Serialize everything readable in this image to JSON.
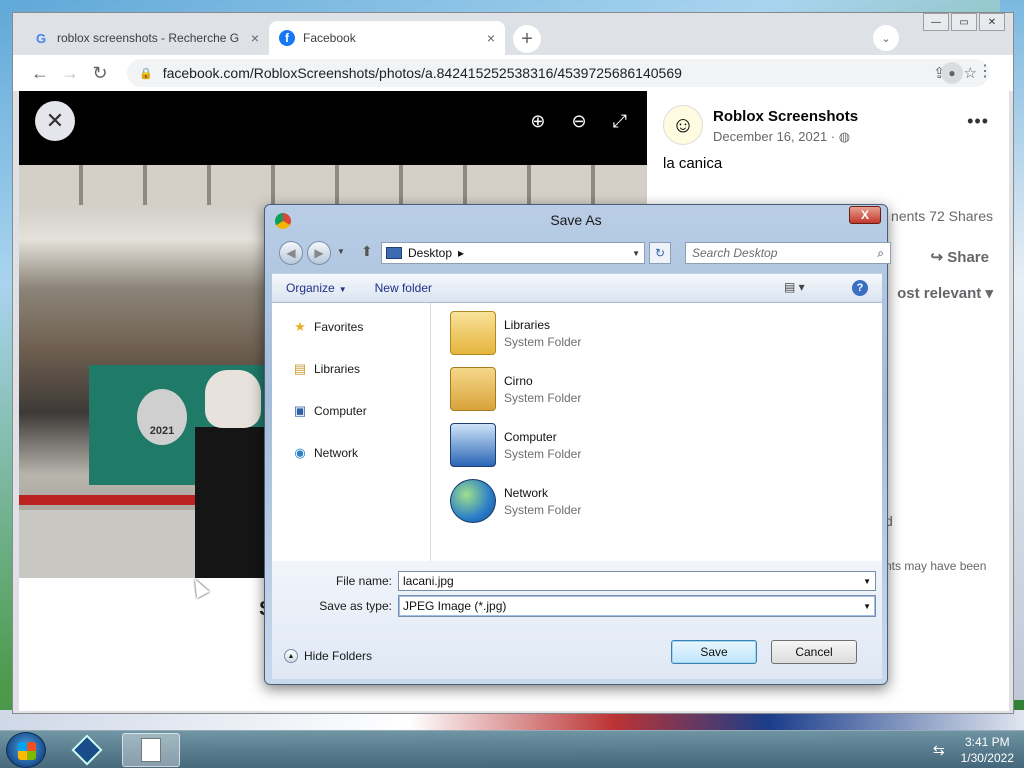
{
  "browser": {
    "tabs": [
      {
        "title": "roblox screenshots - Recherche G",
        "icon": "google-icon",
        "active": false
      },
      {
        "title": "Facebook",
        "icon": "facebook-icon",
        "active": true
      }
    ],
    "url": "facebook.com/RobloxScreenshots/photos/a.842415252538316/4539725686140569",
    "icons": {
      "tab_close": "×",
      "new_tab": "+",
      "tab_search": "⌄",
      "back": "←",
      "forward": "→",
      "reload": "↻",
      "lock": "🔒",
      "share": "⇪",
      "star": "☆",
      "menu": "⋮",
      "profile": "●",
      "win_min": "—",
      "win_max": "▭",
      "win_close": "✕"
    }
  },
  "photo_viewer": {
    "close_icon": "✕",
    "zoom_in_icon": "⊕",
    "zoom_out_icon": "⊖",
    "fullscreen_icon": "⤢",
    "seal_text": "2021",
    "partial_text": "S"
  },
  "post": {
    "author": "Roblox Screenshots",
    "date": "December 16, 2021 · ◍",
    "text": "la canica",
    "stats": "nents  72 Shares",
    "share_label": "Share",
    "share_icon": "↪",
    "sort_label": "ost relevant ▾",
    "more_icon": "•••",
    "partial_1": "d",
    "partial_2": "nts may have been"
  },
  "dialog": {
    "title": "Save As",
    "close_icon": "X",
    "location": "Desktop",
    "search_placeholder": "Search Desktop",
    "organize_label": "Organize",
    "new_folder_label": "New folder",
    "nav_items": [
      {
        "label": "Favorites",
        "icon": "star-icon",
        "glyph": "★"
      },
      {
        "label": "Libraries",
        "icon": "libraries-icon",
        "glyph": "▤"
      },
      {
        "label": "Computer",
        "icon": "computer-icon",
        "glyph": "▣"
      },
      {
        "label": "Network",
        "icon": "network-icon",
        "glyph": "◉"
      }
    ],
    "files": [
      {
        "name": "Libraries",
        "type": "System Folder",
        "icon": "libraries-folder-icon"
      },
      {
        "name": "Cirno",
        "type": "System Folder",
        "icon": "user-folder-icon"
      },
      {
        "name": "Computer",
        "type": "System Folder",
        "icon": "computer-icon"
      },
      {
        "name": "Network",
        "type": "System Folder",
        "icon": "network-globe-icon"
      }
    ],
    "file_name_label": "File name:",
    "file_name_value": "lacani.jpg",
    "save_as_type_label": "Save as type:",
    "save_as_type_value": "JPEG Image (*.jpg)",
    "hide_folders_label": "Hide Folders",
    "save_label": "Save",
    "cancel_label": "Cancel",
    "icons": {
      "back": "◀",
      "forward": "▶",
      "nav_drop": "▼",
      "up": "⬆",
      "path_sep": "▸",
      "path_drop": "▼",
      "refresh": "↻",
      "search": "⌕",
      "view": "▤ ▾",
      "help": "?",
      "dropdown": "▼",
      "hide_folders": "▲"
    }
  },
  "taskbar": {
    "time": "3:41 PM",
    "date": "1/30/2022",
    "network_icon": "⇆"
  }
}
